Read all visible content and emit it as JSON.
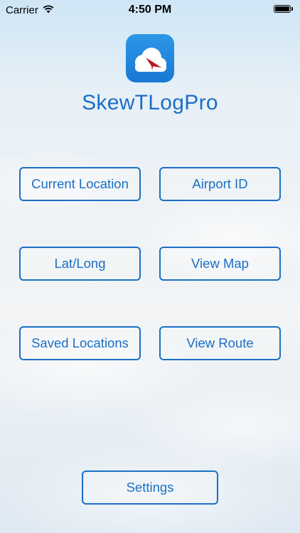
{
  "status_bar": {
    "carrier": "Carrier",
    "time": "4:50 PM",
    "icons": [
      "wifi-icon",
      "battery-icon"
    ]
  },
  "app": {
    "title": "SkewTLogPro",
    "icon": "app-logo-cloud-paper-plane"
  },
  "menu": {
    "current_location": "Current Location",
    "airport_id": "Airport ID",
    "lat_long": "Lat/Long",
    "view_map": "View Map",
    "saved_locations": "Saved Locations",
    "view_route": "View Route",
    "settings": "Settings"
  },
  "colors": {
    "accent": "#1b6fc6",
    "icon_bg": "#1f86de",
    "plane": "#e8262b"
  }
}
